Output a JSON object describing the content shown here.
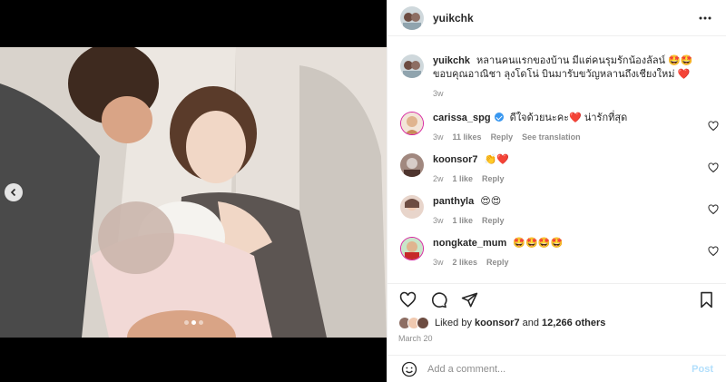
{
  "post": {
    "username": "yuikchk",
    "caption_user": "yuikchk",
    "caption_text": "หลานคนแรกของบ้าน มีแต่คนรุมรักน้องลัลน์ 🤩🤩 ขอบคุณอาณิชา ลุงโดโน่ บินมารับขวัญหลานถึงเชียงใหม่ ❤️",
    "caption_time": "3w",
    "likes_prefix": "Liked by",
    "likes_user": "koonsor7",
    "likes_and": "and",
    "likes_count": "12,266 others",
    "date": "March 20",
    "comment_placeholder": "Add a comment...",
    "post_label": "Post"
  },
  "comments": [
    {
      "user": "carissa_spg",
      "verified": true,
      "text": "ดีใจด้วยนะคะ❤️ น่ารักที่สุด",
      "time": "3w",
      "likes": "11 likes",
      "reply": "Reply",
      "translate": "See translation"
    },
    {
      "user": "koonsor7",
      "text": "👏❤️",
      "time": "2w",
      "likes": "1 like",
      "reply": "Reply"
    },
    {
      "user": "panthyla",
      "text": "😍😍",
      "time": "3w",
      "likes": "1 like",
      "reply": "Reply"
    },
    {
      "user": "nongkate_mum",
      "text": "🤩🤩🤩🤩",
      "time": "3w",
      "likes": "2 likes",
      "reply": "Reply"
    }
  ],
  "colors": {
    "accent": "#3897f0",
    "heart": "#ed4956",
    "muted": "#8e8e8e",
    "post_disabled": "#b2dffc"
  },
  "carousel": {
    "current": 1,
    "total": 3
  }
}
